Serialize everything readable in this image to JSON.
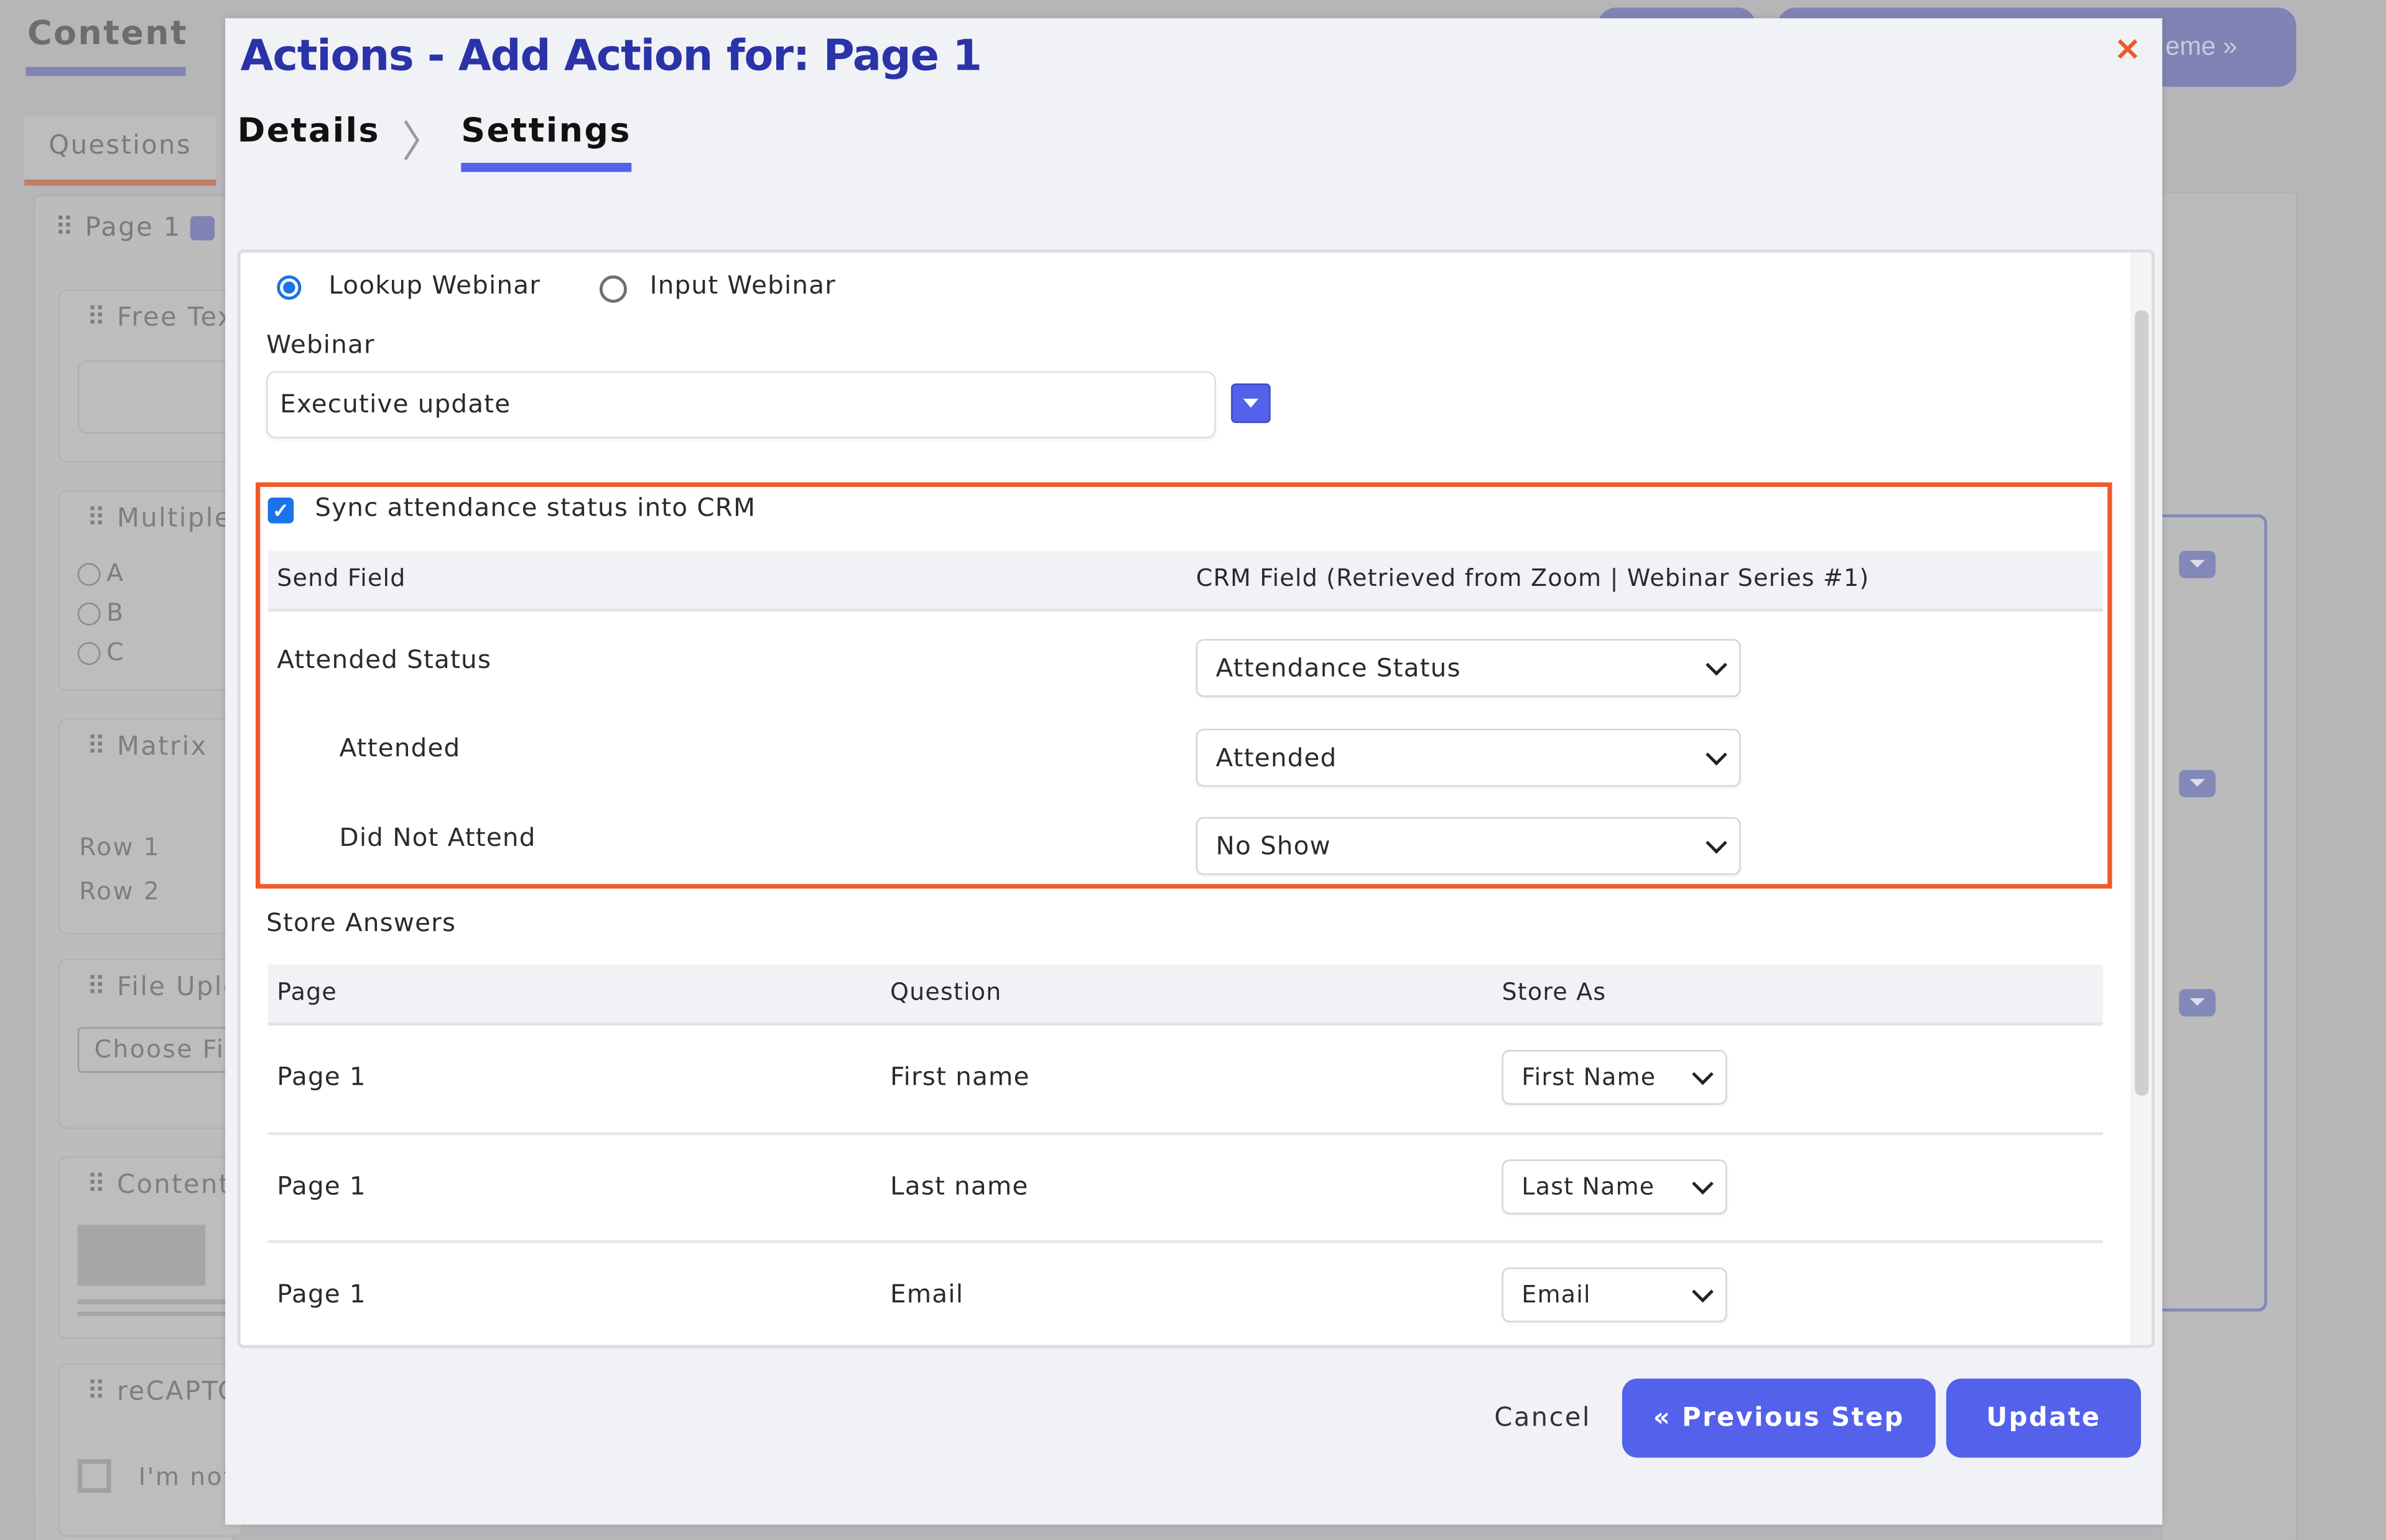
{
  "background": {
    "section_title": "Content",
    "top_button_partial": "eme »",
    "tab": "Questions",
    "page_label": "Page 1",
    "cards": [
      {
        "title": "Free Tex"
      },
      {
        "title": "Multiple",
        "options": [
          "A",
          "B",
          "C"
        ]
      },
      {
        "title": "Matrix",
        "rows": [
          "Row 1",
          "Row 2"
        ]
      },
      {
        "title": "File Uplo",
        "button": "Choose Fi"
      },
      {
        "title": "Content"
      },
      {
        "title": "reCAPTC",
        "checkbox_label": "I'm not"
      }
    ]
  },
  "modal": {
    "title": "Actions - Add Action for: Page 1",
    "close_icon": "×",
    "steps": [
      {
        "label": "Details",
        "active": false
      },
      {
        "label": "Settings",
        "active": true
      }
    ],
    "webinar_mode": {
      "options": [
        "Lookup Webinar",
        "Input Webinar"
      ],
      "selected": "Lookup Webinar"
    },
    "webinar_label": "Webinar",
    "webinar_value": "Executive update",
    "sync": {
      "checkbox_label": "Sync attendance status into CRM",
      "checked": true,
      "headers": [
        "Send Field",
        "CRM Field (Retrieved from Zoom | Webinar Series #1)"
      ],
      "rows": [
        {
          "send_field": "Attended Status",
          "crm_field": "Attendance Status"
        },
        {
          "send_field": "Attended",
          "crm_field": "Attended"
        },
        {
          "send_field": "Did Not Attend",
          "crm_field": "No Show"
        }
      ]
    },
    "store_answers": {
      "title": "Store Answers",
      "headers": [
        "Page",
        "Question",
        "Store As"
      ],
      "rows": [
        {
          "page": "Page 1",
          "question": "First name",
          "store_as": "First Name"
        },
        {
          "page": "Page 1",
          "question": "Last name",
          "store_as": "Last Name"
        },
        {
          "page": "Page 1",
          "question": "Email",
          "store_as": "Email"
        }
      ]
    },
    "footer": {
      "cancel": "Cancel",
      "previous": "« Previous Step",
      "update": "Update"
    }
  },
  "colors": {
    "accent": "#5461ea",
    "title": "#2a33a8",
    "highlight": "#f05a28",
    "close": "#f05a28"
  }
}
